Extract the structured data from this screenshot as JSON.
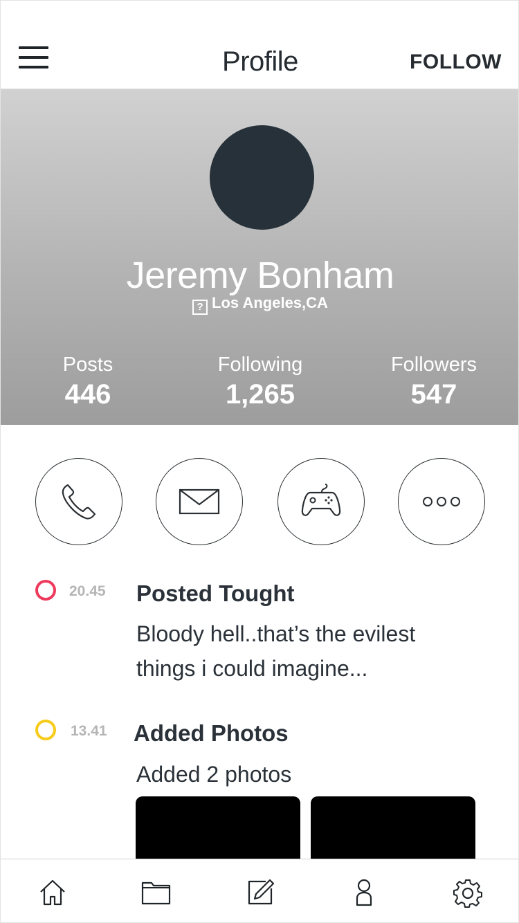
{
  "header": {
    "title": "Profile",
    "follow_label": "FOLLOW",
    "menu_icon": "hamburger-menu-icon"
  },
  "profile": {
    "name": "Jeremy Bonham",
    "location": "Los Angeles,CA",
    "location_icon": "?",
    "avatar_color": "#263139"
  },
  "stats": [
    {
      "label": "Posts",
      "value": "446"
    },
    {
      "label": "Following",
      "value": "1,265"
    },
    {
      "label": "Followers",
      "value": "547"
    }
  ],
  "actions": [
    "phone-icon",
    "mail-icon",
    "gamepad-icon",
    "more-icon"
  ],
  "timeline": [
    {
      "time": "20.45",
      "title": "Posted Tought",
      "text_line1": "Bloody hell..that’s the evilest",
      "text_line2": "things i could imagine...",
      "dot_color": "#ee3a5d"
    },
    {
      "time": "13.41",
      "title": "Added Photos",
      "text": "Added 2 photos",
      "dot_color": "#f7cb1a",
      "photo_count": 2
    }
  ],
  "tabbar": [
    "home-icon",
    "folder-icon",
    "edit-icon",
    "user-icon",
    "settings-icon"
  ]
}
